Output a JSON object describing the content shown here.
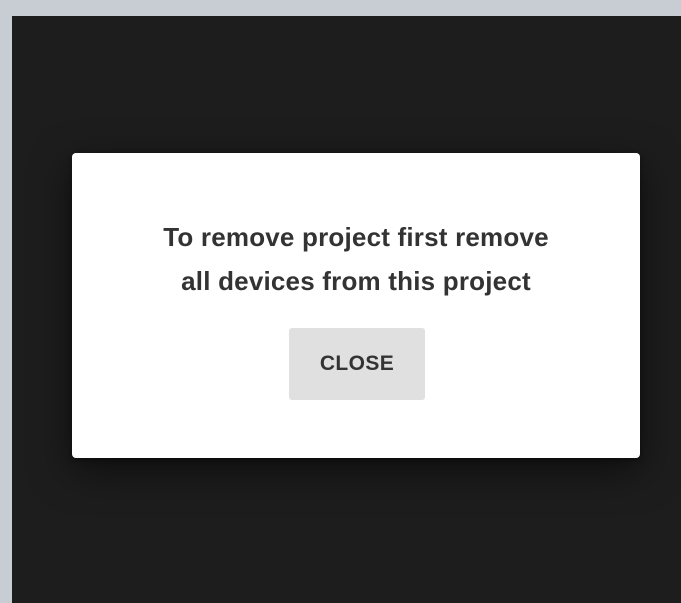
{
  "colors": {
    "outer_background": "#c8ccd3",
    "app_background": "#1d1d1d",
    "dialog_background": "#ffffff",
    "button_background": "#e0e0e0",
    "text": "#333333"
  },
  "dialog": {
    "message_lines": [
      "To remove project first remove",
      "all devices from this project"
    ],
    "close_label": "CLOSE"
  }
}
